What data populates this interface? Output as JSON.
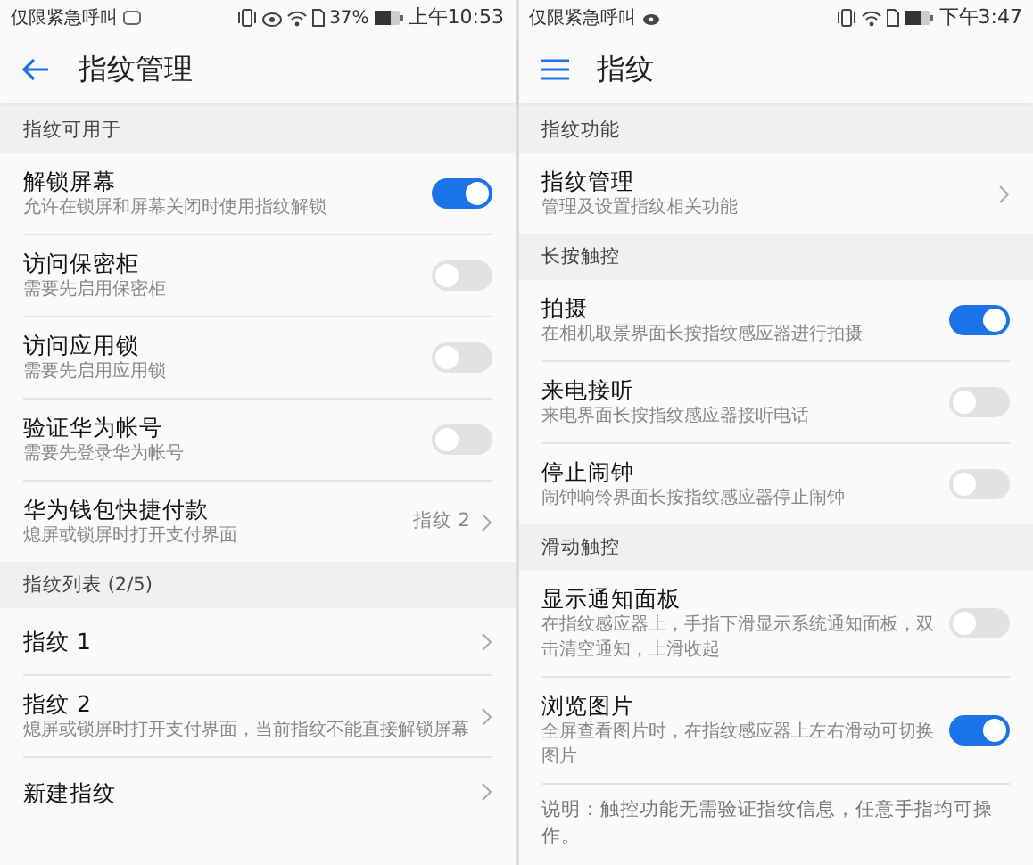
{
  "panels": [
    {
      "status_bar": {
        "carrier": "仅限紧急呼叫",
        "battery_text": "37%",
        "time": "上午10:53",
        "icons": [
          {
            "kind": "notice"
          },
          {
            "kind": "vibrate"
          },
          {
            "kind": "eye"
          },
          {
            "kind": "wifi"
          },
          {
            "kind": "sim"
          },
          {
            "kind": "battery"
          }
        ]
      },
      "header": {
        "kind": "back",
        "title": "指纹管理"
      },
      "sections": [
        {
          "title": "指纹可用于",
          "items": [
            {
              "kind": "toggle",
              "title": "解锁屏幕",
              "subtitle": "允许在锁屏和屏幕关闭时使用指纹解锁",
              "on": true
            },
            {
              "kind": "toggle",
              "title": "访问保密柜",
              "subtitle": "需要先启用保密柜",
              "on": false
            },
            {
              "kind": "toggle",
              "title": "访问应用锁",
              "subtitle": "需要先启用应用锁",
              "on": false
            },
            {
              "kind": "toggle",
              "title": "验证华为帐号",
              "subtitle": "需要先登录华为帐号",
              "on": false
            },
            {
              "kind": "link",
              "title": "华为钱包快捷付款",
              "subtitle": "熄屏或锁屏时打开支付界面",
              "value": "指纹 2"
            }
          ]
        },
        {
          "title": "指纹列表 (2/5)",
          "items": [
            {
              "kind": "link",
              "title": "指纹 1"
            },
            {
              "kind": "link",
              "title": "指纹 2",
              "subtitle": "熄屏或锁屏时打开支付界面，当前指纹不能直接解锁屏幕"
            },
            {
              "kind": "link",
              "title": "新建指纹"
            }
          ]
        }
      ]
    },
    {
      "status_bar": {
        "carrier": "仅限紧急呼叫",
        "time": "下午3:47",
        "icons": [
          {
            "kind": "weibo"
          },
          {
            "kind": "vibrate"
          },
          {
            "kind": "wifi"
          },
          {
            "kind": "sim"
          },
          {
            "kind": "battery"
          }
        ]
      },
      "header": {
        "kind": "menu",
        "title": "指纹"
      },
      "sections": [
        {
          "title": "指纹功能",
          "items": [
            {
              "kind": "link",
              "title": "指纹管理",
              "subtitle": "管理及设置指纹相关功能"
            }
          ]
        },
        {
          "title": "长按触控",
          "items": [
            {
              "kind": "toggle",
              "title": "拍摄",
              "subtitle": "在相机取景界面长按指纹感应器进行拍摄",
              "on": true
            },
            {
              "kind": "toggle",
              "title": "来电接听",
              "subtitle": "来电界面长按指纹感应器接听电话",
              "on": false
            },
            {
              "kind": "toggle",
              "title": "停止闹钟",
              "subtitle": "闹钟响铃界面长按指纹感应器停止闹钟",
              "on": false
            }
          ]
        },
        {
          "title": "滑动触控",
          "items": [
            {
              "kind": "toggle",
              "title": "显示通知面板",
              "subtitle": "在指纹感应器上，手指下滑显示系统通知面板，双击清空通知，上滑收起",
              "on": false
            },
            {
              "kind": "toggle",
              "title": "浏览图片",
              "subtitle": "全屏查看图片时，在指纹感应器上左右滑动可切换图片",
              "on": true
            },
            {
              "kind": "note",
              "text": "说明：触控功能无需验证指纹信息，任意手指均可操作。"
            }
          ]
        }
      ]
    }
  ]
}
